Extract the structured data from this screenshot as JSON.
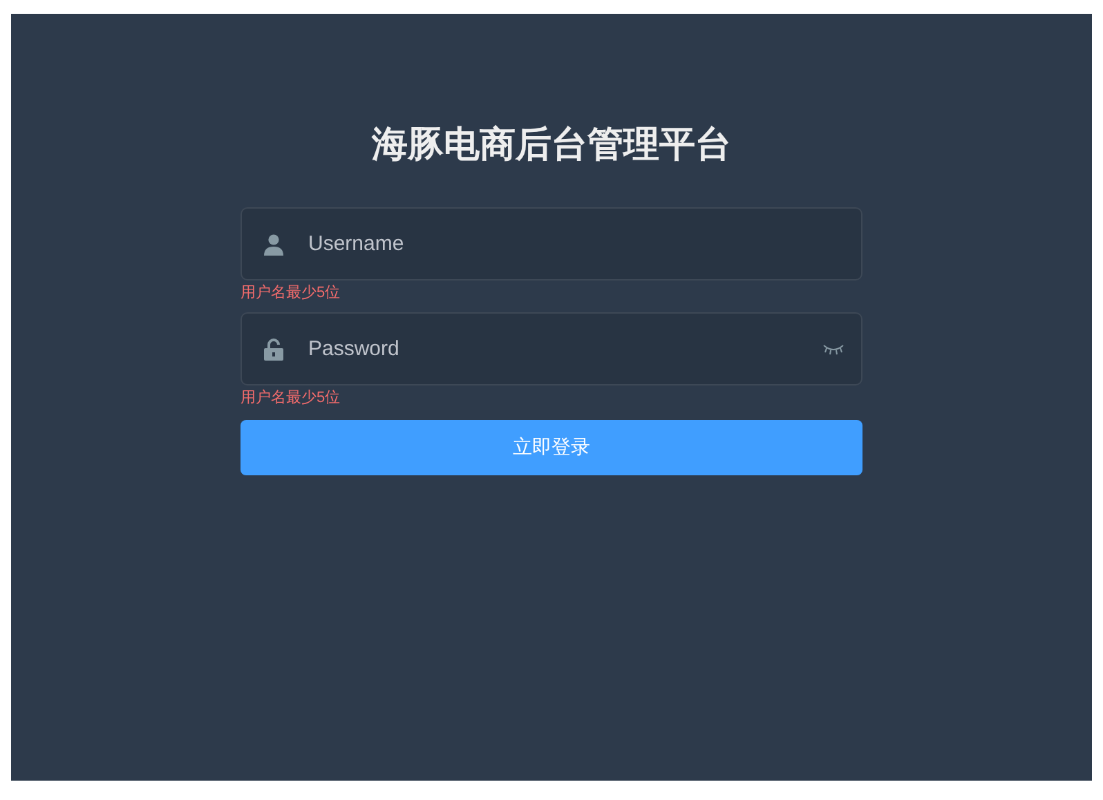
{
  "title": "海豚电商后台管理平台",
  "fields": [
    {
      "kind": "username",
      "placeholder": "Username",
      "error": "用户名最少5位"
    },
    {
      "kind": "password",
      "placeholder": "Password",
      "error": "用户名最少5位"
    }
  ],
  "submit": "立即登录"
}
